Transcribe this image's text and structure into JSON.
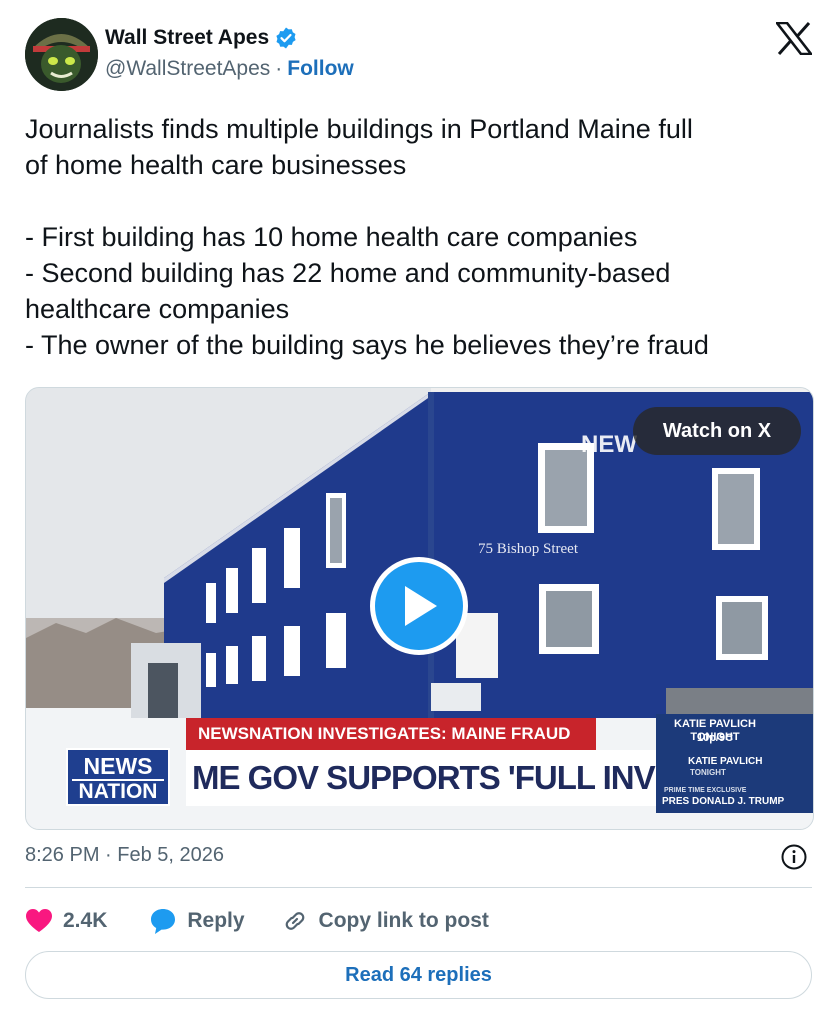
{
  "author": {
    "display_name": "Wall Street Apes",
    "handle": "@WallStreetApes",
    "separator": "·",
    "follow_label": "Follow",
    "verified": true
  },
  "tweet": {
    "lines": [
      "Journalists finds multiple buildings in Portland Maine full",
      "of home health care businesses",
      "",
      "- First building has 10 home health care companies",
      "- Second building has 22 home and community-based",
      "healthcare companies",
      "- The owner of the building says he believes they’re fraud"
    ]
  },
  "media": {
    "watch_label": "Watch on X",
    "watermark": "NEW",
    "building_sign": "75 Bishop Street",
    "ticker_top": "NEWSNATION INVESTIGATES: MAINE FRAUD",
    "ticker_main": "ME GOV SUPPORTS 'FULL INVESTIGATION'",
    "logo_line1": "NEWS",
    "logo_line2": "NATION",
    "promo": {
      "show": "KATIE PAVLICH TONIGHT",
      "time": "10p/9C",
      "host": "KATIE PAVLICH",
      "host_sub": "TONIGHT",
      "tag": "PRIME TIME EXCLUSIVE",
      "guest": "PRES DONALD J. TRUMP"
    }
  },
  "meta": {
    "timestamp": "8:26 PM · Feb 5, 2026"
  },
  "actions": {
    "like_count": "2.4K",
    "reply_label": "Reply",
    "copy_label": "Copy link to post"
  },
  "replies_button": "Read 64 replies",
  "colors": {
    "accent": "#1d9bf0",
    "link": "#1d6fba",
    "like": "#f91880",
    "muted": "#536471",
    "border": "#cfd9de"
  }
}
